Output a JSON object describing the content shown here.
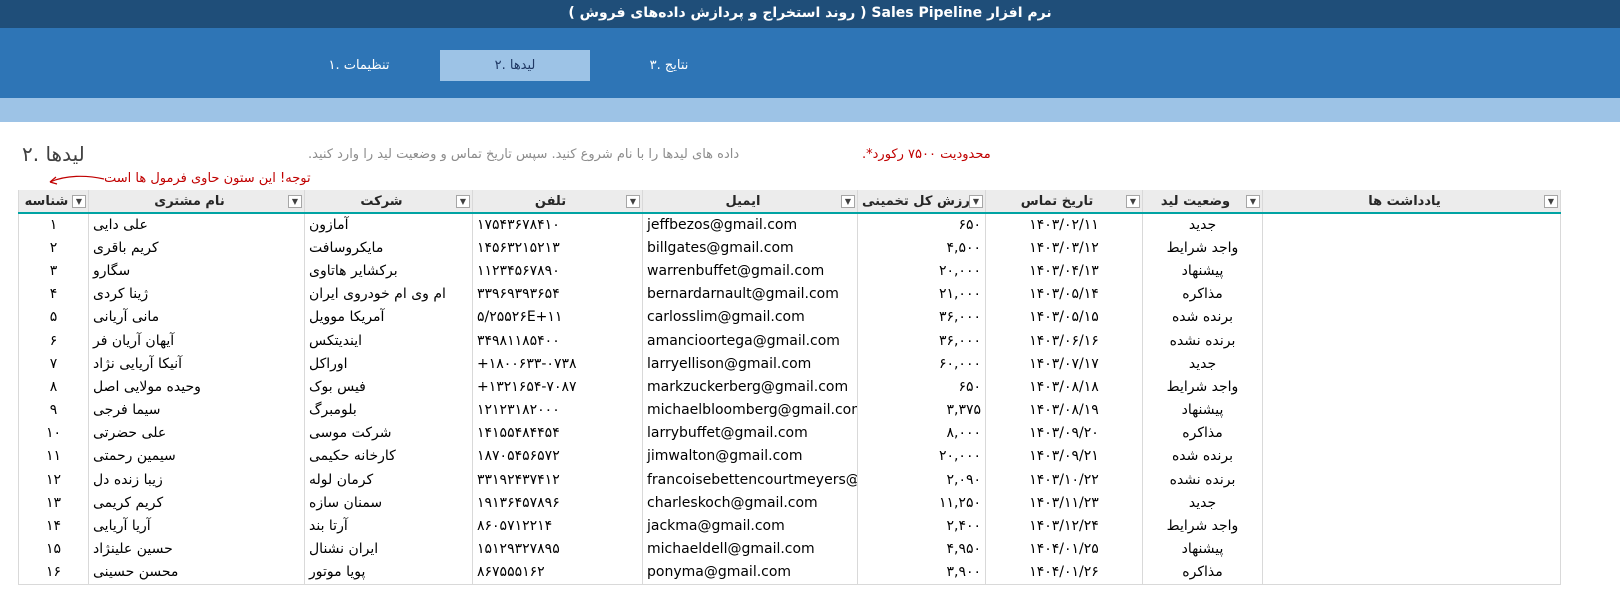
{
  "app": {
    "title": "نرم افزار Sales Pipeline ( روند استخراج و  پردازش داده‌های فروش )"
  },
  "tabs": [
    {
      "label": "تنظیمات .۱",
      "active": false
    },
    {
      "label": "لیدها .۲",
      "active": true
    },
    {
      "label": "نتایج .۳",
      "active": false
    }
  ],
  "section": {
    "title": "لیدها .۲",
    "hint": "داده های لیدها را با نام شروع کنید. سپس تاریخ تماس و وضعیت لید را وارد کنید.",
    "limit_note": "محدودیت ۷۵۰۰ رکورد*.",
    "formula_warning": "توجه! این ستون حاوی فرمول ها است"
  },
  "table": {
    "headers": {
      "id": "شناسه",
      "name": "نام مشتری",
      "company": "شرکت",
      "phone": "تلفن",
      "email": "ایمیل",
      "value": "ارزش کل تخمینی",
      "date": "تاریخ تماس",
      "status": "وضعیت لید",
      "notes": "یادداشت ها"
    },
    "rows": [
      {
        "id": "۱",
        "name": "علی دایی",
        "company": "آمازون",
        "phone": "۱۷۵۴۳۶۷۸۴۱۰",
        "email": "jeffbezos@gmail.com",
        "value": "۶۵۰",
        "date": "۱۴۰۳/۰۲/۱۱",
        "status": "جدید",
        "notes": ""
      },
      {
        "id": "۲",
        "name": "کریم باقری",
        "company": "مایکروسافت",
        "phone": "۱۴۵۶۳۲۱۵۲۱۳",
        "email": "billgates@gmail.com",
        "value": "۴,۵۰۰",
        "date": "۱۴۰۳/۰۳/۱۲",
        "status": "واجد شرایط",
        "notes": ""
      },
      {
        "id": "۳",
        "name": "سگارو",
        "company": "برکشایر هاتاوی",
        "phone": "۱۱۲۳۴۵۶۷۸۹۰",
        "email": "warrenbuffet@gmail.com",
        "value": "۲۰,۰۰۰",
        "date": "۱۴۰۳/۰۴/۱۳",
        "status": "پیشنهاد",
        "notes": ""
      },
      {
        "id": "۴",
        "name": "ژینا کردی",
        "company": "ام وی ام خودروی ایران",
        "phone": "۳۳۹۶۹۳۹۳۶۵۴",
        "email": "bernardarnault@gmail.com",
        "value": "۲۱,۰۰۰",
        "date": "۱۴۰۳/۰۵/۱۴",
        "status": "مذاکره",
        "notes": ""
      },
      {
        "id": "۵",
        "name": "مانی آریانی",
        "company": "آمریکا موویل",
        "phone": "۵/۲۵۵۲۶E+۱۱",
        "email": "carlosslim@gmail.com",
        "value": "۳۶,۰۰۰",
        "date": "۱۴۰۳/۰۵/۱۵",
        "status": "برنده شده",
        "notes": ""
      },
      {
        "id": "۶",
        "name": "آیهان آریان فر",
        "company": "ایندیتکس",
        "phone": "۳۴۹۸۱۱۸۵۴۰۰",
        "email": "amancioortega@gmail.com",
        "value": "۳۶,۰۰۰",
        "date": "۱۴۰۳/۰۶/۱۶",
        "status": "برنده نشده",
        "notes": ""
      },
      {
        "id": "۷",
        "name": "آنیکا آریایی نژاد",
        "company": "اوراکل",
        "phone": "+۱۸۰۰۶۳۳-۰۷۳۸",
        "email": "larryellison@gmail.com",
        "value": "۶۰,۰۰۰",
        "date": "۱۴۰۳/۰۷/۱۷",
        "status": "جدید",
        "notes": ""
      },
      {
        "id": "۸",
        "name": "وحیده مولایی اصل",
        "company": "فیس بوک",
        "phone": "+۱۳۲۱۶۵۴-۷۰۸۷",
        "email": "markzuckerberg@gmail.com",
        "value": "۶۵۰",
        "date": "۱۴۰۳/۰۸/۱۸",
        "status": "واجد شرایط",
        "notes": ""
      },
      {
        "id": "۹",
        "name": "سیما فرجی",
        "company": "بلومبرگ",
        "phone": "۱۲۱۲۳۱۸۲۰۰۰",
        "email": "michaelbloomberg@gmail.com",
        "value": "۳,۳۷۵",
        "date": "۱۴۰۳/۰۸/۱۹",
        "status": "پیشنهاد",
        "notes": ""
      },
      {
        "id": "۱۰",
        "name": "علی حضرتی",
        "company": "شرکت موسی",
        "phone": "۱۴۱۵۵۴۸۴۴۵۴",
        "email": "larrybuffet@gmail.com",
        "value": "۸,۰۰۰",
        "date": "۱۴۰۳/۰۹/۲۰",
        "status": "مذاکره",
        "notes": ""
      },
      {
        "id": "۱۱",
        "name": "سیمین رحمتی",
        "company": "کارخانه حکیمی",
        "phone": "۱۸۷۰۵۴۵۶۵۷۲",
        "email": "jimwalton@gmail.com",
        "value": "۲۰,۰۰۰",
        "date": "۱۴۰۳/۰۹/۲۱",
        "status": "برنده شده",
        "notes": ""
      },
      {
        "id": "۱۲",
        "name": "زیبا زنده دل",
        "company": "کرمان لوله",
        "phone": "۳۳۱۹۲۴۳۷۴۱۲",
        "email": "francoisebettencourtmeyers@gmail.com",
        "value": "۲,۰۹۰",
        "date": "۱۴۰۳/۱۰/۲۲",
        "status": "برنده نشده",
        "notes": ""
      },
      {
        "id": "۱۳",
        "name": "کریم کریمی",
        "company": "سمنان سازه",
        "phone": "۱۹۱۳۶۴۵۷۸۹۶",
        "email": "charleskoch@gmail.com",
        "value": "۱۱,۲۵۰",
        "date": "۱۴۰۳/۱۱/۲۳",
        "status": "جدید",
        "notes": ""
      },
      {
        "id": "۱۴",
        "name": "آریا آریایی",
        "company": "آرتا بند",
        "phone": "۸۶۰۵۷۱۲۲۱۴",
        "email": "jackma@gmail.com",
        "value": "۲,۴۰۰",
        "date": "۱۴۰۳/۱۲/۲۴",
        "status": "واجد شرایط",
        "notes": ""
      },
      {
        "id": "۱۵",
        "name": "حسین علینژاد",
        "company": "ایران نشنال",
        "phone": "۱۵۱۲۹۳۲۷۸۹۵",
        "email": "michaeldell@gmail.com",
        "value": "۴,۹۵۰",
        "date": "۱۴۰۴/۰۱/۲۵",
        "status": "پیشنهاد",
        "notes": ""
      },
      {
        "id": "۱۶",
        "name": "محسن حسینی",
        "company": "پویا موتور",
        "phone": "۸۶۷۵۵۵۱۶۲",
        "email": "ponyma@gmail.com",
        "value": "۳,۹۰۰",
        "date": "۱۴۰۴/۰۱/۲۶",
        "status": "مذاکره",
        "notes": ""
      }
    ]
  }
}
